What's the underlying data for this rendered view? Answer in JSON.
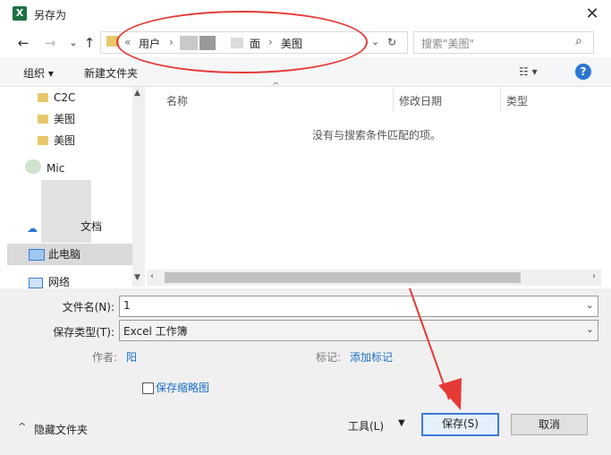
{
  "window": {
    "title": "另存为",
    "app_icon": "X"
  },
  "nav": {
    "back_icon": "←",
    "forward_icon": "→",
    "dropdown_icon": "⌄",
    "up_icon": "↑"
  },
  "address": {
    "overflow": "«",
    "crumbs": [
      "用户",
      "面",
      "美图"
    ],
    "sep": "›",
    "dropdown_icon": "⌄",
    "refresh_icon": "↻"
  },
  "search": {
    "placeholder": "搜索\"美图\"",
    "icon": "⌕"
  },
  "toolbar": {
    "organize": "组织 ▾",
    "new_folder": "新建文件夹",
    "view_icon": "☷ ▾",
    "help": "?"
  },
  "sidebar": {
    "items": [
      {
        "label": "C2C"
      },
      {
        "label": "美图"
      },
      {
        "label": "美图"
      },
      {
        "label": "Mic"
      },
      {
        "label": "文档"
      },
      {
        "label": "此电脑"
      },
      {
        "label": "网络"
      }
    ]
  },
  "filelist": {
    "columns": [
      "名称",
      "修改日期",
      "类型"
    ],
    "empty_text": "没有与搜索条件匹配的项。"
  },
  "form": {
    "filename_label": "文件名(N):",
    "filename_value": "1",
    "filetype_label": "保存类型(T):",
    "filetype_value": "Excel 工作簿",
    "author_label": "作者:",
    "author_value": "阳",
    "tags_label": "标记:",
    "tags_value": "添加标记",
    "thumbnail_label": "保存缩略图"
  },
  "footer": {
    "hide_folders": "隐藏文件夹",
    "tools": "工具(L)",
    "save": "保存(S)",
    "cancel": "取消"
  },
  "colors": {
    "accent": "#2b76d2",
    "annotation": "#e53935",
    "folder": "#e8c66a"
  }
}
